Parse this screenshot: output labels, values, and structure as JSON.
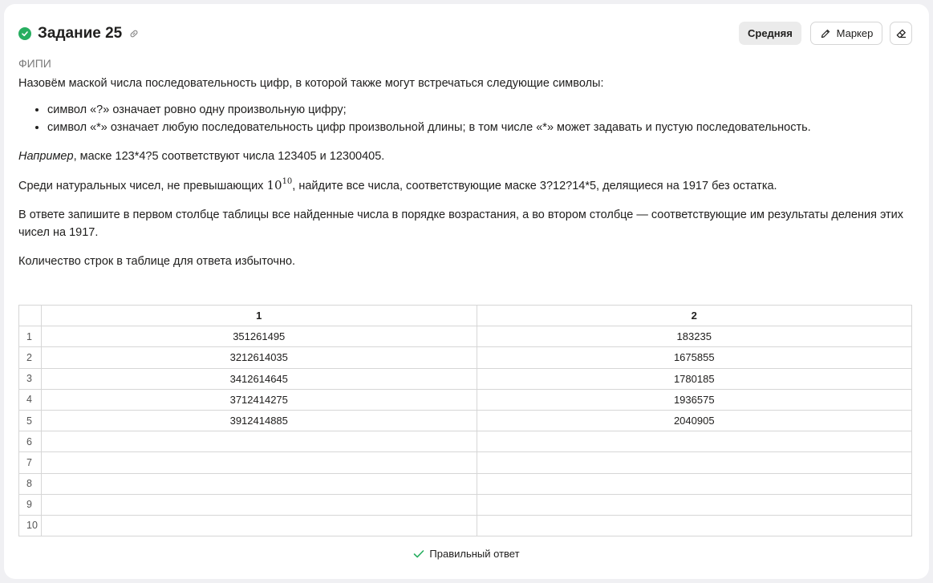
{
  "header": {
    "title": "Задание 25"
  },
  "toolbar": {
    "level_label": "Средняя",
    "marker_label": "Маркер"
  },
  "source": "ФИПИ",
  "problem": {
    "intro": "Назовём маской числа последовательность цифр, в которой также могут встречаться следующие символы:",
    "rules": [
      "символ «?» означает ровно одну произвольную цифру;",
      "символ «*» означает любую последовательность цифр произвольной длины; в том числе «*» может задавать и пустую последовательность."
    ],
    "example_italic": "Например",
    "example_rest": ", маске 123*4?5 соответствуют числа 123405 и 12300405.",
    "task_before": "Среди натуральных чисел, не превышающих ",
    "task_base": "10",
    "task_exp": "10",
    "task_after": ", найдите все числа, соответствующие маске 3?12?14*5, делящиеся на 1917 без остатка.",
    "answer_instructions": "В ответе запишите в первом столбце таблицы все найденные числа в порядке возрастания, а во втором столбце — соответствующие им результаты деления этих чисел на 1917.",
    "rows_note": "Количество строк в таблице для ответа избыточно."
  },
  "table": {
    "headers": [
      "1",
      "2"
    ],
    "rows": [
      {
        "num": "1",
        "c1": "351261495",
        "c2": "183235"
      },
      {
        "num": "2",
        "c1": "3212614035",
        "c2": "1675855"
      },
      {
        "num": "3",
        "c1": "3412614645",
        "c2": "1780185"
      },
      {
        "num": "4",
        "c1": "3712414275",
        "c2": "1936575"
      },
      {
        "num": "5",
        "c1": "3912414885",
        "c2": "2040905"
      },
      {
        "num": "6",
        "c1": "",
        "c2": ""
      },
      {
        "num": "7",
        "c1": "",
        "c2": ""
      },
      {
        "num": "8",
        "c1": "",
        "c2": ""
      },
      {
        "num": "9",
        "c1": "",
        "c2": ""
      },
      {
        "num": "10",
        "c1": "",
        "c2": ""
      }
    ]
  },
  "status": {
    "correct_label": "Правильный ответ",
    "color": "#27ae60"
  },
  "icons": [
    "check-circle-icon",
    "link-icon",
    "pencil-icon",
    "eraser-icon",
    "checkmark-icon"
  ]
}
